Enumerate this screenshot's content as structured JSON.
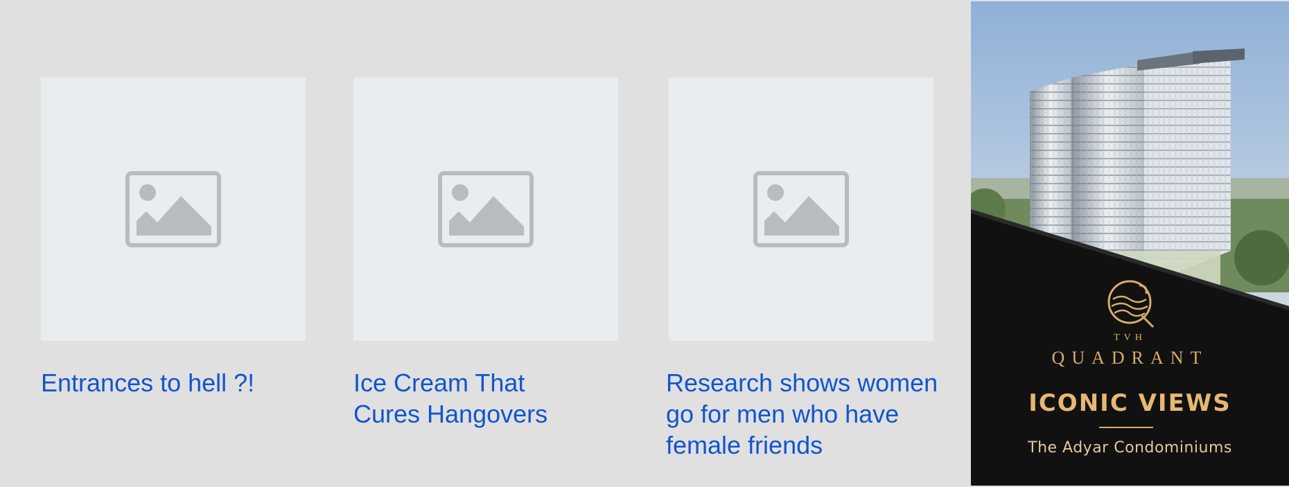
{
  "articles": [
    {
      "title_lines": [
        "Entrances to hell ?!"
      ],
      "icon": "image-placeholder-icon"
    },
    {
      "title_lines": [
        "Ice Cream That",
        "Cures Hangovers"
      ],
      "icon": "image-placeholder-icon"
    },
    {
      "title_lines": [
        "Research shows women",
        "go for men who have",
        "female friends"
      ],
      "icon": "image-placeholder-icon"
    }
  ],
  "ad": {
    "brand_small": "TVH",
    "brand": "QUADRANT",
    "headline": "ICONIC VIEWS",
    "subtitle": "The  Adyar Condominiums",
    "logo_icon": "quadrant-logo-icon"
  },
  "colors": {
    "page_bg": "#e0e0e0",
    "thumb_bg": "#e9edf0",
    "placeholder_icon": "#b9bcbe",
    "link": "#1155cc",
    "ad_gold": "#d9ad6a"
  }
}
